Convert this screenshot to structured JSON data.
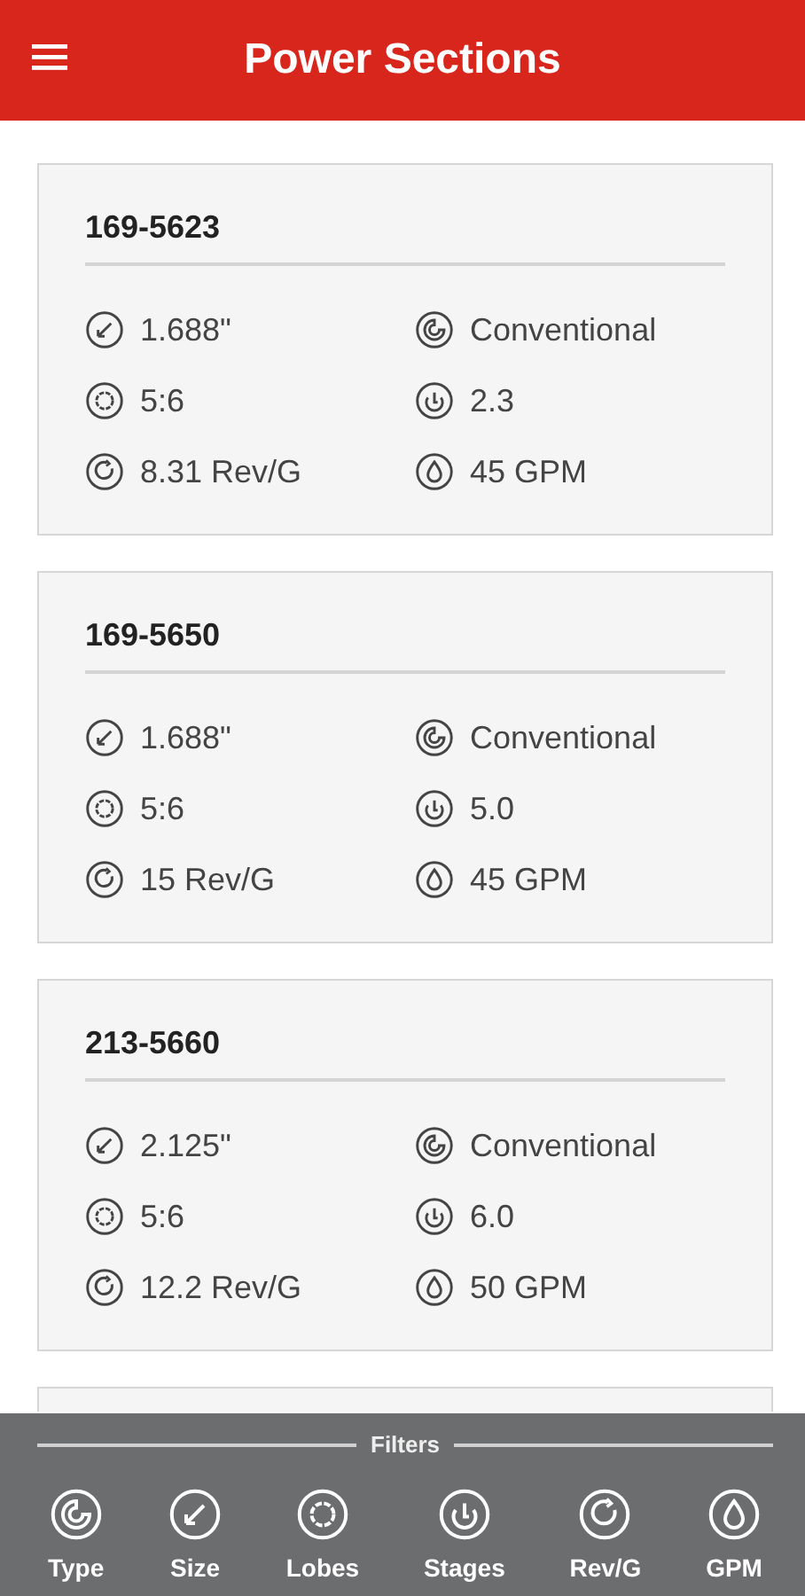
{
  "app_bar": {
    "title": "Power Sections"
  },
  "sections": [
    {
      "title": "169-5623",
      "stats": [
        {
          "kind": "size",
          "text": "1.688\""
        },
        {
          "kind": "type",
          "text": "Conventional"
        },
        {
          "kind": "lobes",
          "text": "5:6"
        },
        {
          "kind": "stages",
          "text": "2.3"
        },
        {
          "kind": "revg",
          "text": "8.31 Rev/G"
        },
        {
          "kind": "gpm",
          "text": "45 GPM"
        }
      ]
    },
    {
      "title": "169-5650",
      "stats": [
        {
          "kind": "size",
          "text": "1.688\""
        },
        {
          "kind": "type",
          "text": "Conventional"
        },
        {
          "kind": "lobes",
          "text": "5:6"
        },
        {
          "kind": "stages",
          "text": "5.0"
        },
        {
          "kind": "revg",
          "text": "15 Rev/G"
        },
        {
          "kind": "gpm",
          "text": "45 GPM"
        }
      ]
    },
    {
      "title": "213-5660",
      "stats": [
        {
          "kind": "size",
          "text": "2.125\""
        },
        {
          "kind": "type",
          "text": "Conventional"
        },
        {
          "kind": "lobes",
          "text": "5:6"
        },
        {
          "kind": "stages",
          "text": "6.0"
        },
        {
          "kind": "revg",
          "text": "12.2 Rev/G"
        },
        {
          "kind": "gpm",
          "text": "50 GPM"
        }
      ]
    }
  ],
  "filters": {
    "heading": "Filters",
    "items": [
      {
        "kind": "type",
        "label": "Type"
      },
      {
        "kind": "size",
        "label": "Size"
      },
      {
        "kind": "lobes",
        "label": "Lobes"
      },
      {
        "kind": "stages",
        "label": "Stages"
      },
      {
        "kind": "revg",
        "label": "Rev/G"
      },
      {
        "kind": "gpm",
        "label": "GPM"
      }
    ]
  }
}
